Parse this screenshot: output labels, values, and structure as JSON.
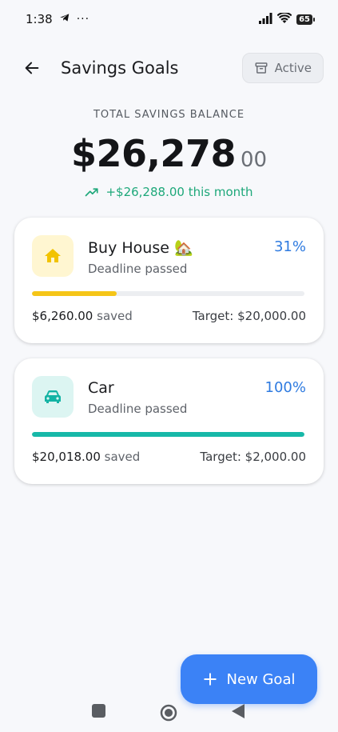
{
  "status_bar": {
    "time": "1:38",
    "dots": "···",
    "battery": "65"
  },
  "header": {
    "title": "Savings Goals",
    "filter_label": "Active"
  },
  "balance": {
    "label": "TOTAL SAVINGS BALANCE",
    "amount_main": "$26,278",
    "amount_cents": "00",
    "change_text": "+$26,288.00 this month"
  },
  "goals": [
    {
      "name": "Buy House 🏡",
      "deadline": "Deadline passed",
      "percent": "31%",
      "progress": 0.31,
      "saved_amount": "$6,260.00",
      "saved_word": "saved",
      "target": "Target: $20,000.00",
      "icon": "home-icon",
      "icon_bg": "#fff6d1",
      "icon_color": "#f2c300",
      "bar_color": "#f5c518"
    },
    {
      "name": "Car",
      "deadline": "Deadline passed",
      "percent": "100%",
      "progress": 1.0,
      "saved_amount": "$20,018.00",
      "saved_word": "saved",
      "target": "Target: $2,000.00",
      "icon": "car-icon",
      "icon_bg": "#dcf5f2",
      "icon_color": "#13b3a4",
      "bar_color": "#17b8a8"
    }
  ],
  "fab": {
    "label": "New Goal"
  },
  "colors": {
    "accent": "#3b82f6",
    "positive": "#1ea87a",
    "percent": "#2f7be0"
  }
}
